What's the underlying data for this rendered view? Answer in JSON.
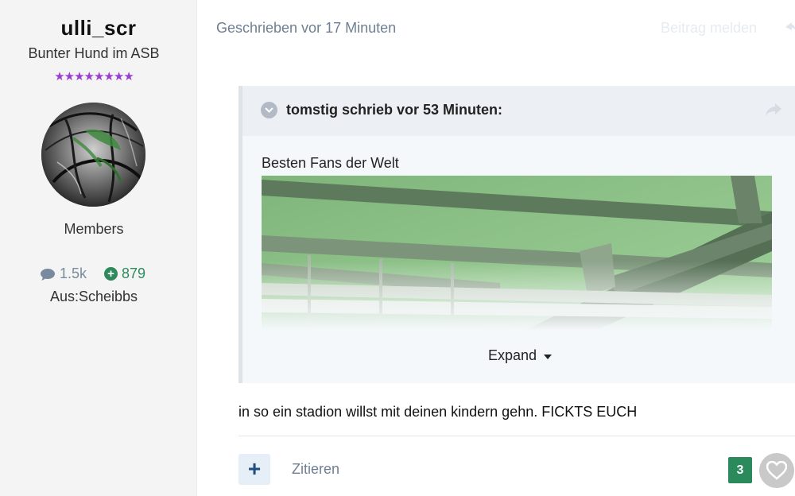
{
  "author": {
    "username": "ulli_scr",
    "title": "Bunter Hund im ASB",
    "stars": "★★★★★★★★",
    "group": "Members",
    "posts_count": "1.5k",
    "reputation": "879",
    "location": "Aus:Scheibbs",
    "colors": {
      "stars": "#9a3dd1",
      "reputation": "#2e8a5c",
      "posts": "#7a8a9e"
    }
  },
  "post": {
    "date": "Geschrieben vor 17 Minuten",
    "report_label": "Beitrag melden",
    "body": "in so ein stadion willst mit deinen kindern gehn. FICKTS EUCH"
  },
  "quote": {
    "citation": "tomstig schrieb vor 53 Minuten:",
    "text": "Besten Fans der Welt",
    "expand_label": "Expand"
  },
  "footer": {
    "quote_label": "Zitieren",
    "add_label": "+",
    "reaction_count": "3",
    "colors": {
      "reaction": "#2a8a5c",
      "add_button_bg": "#e6eff8"
    }
  },
  "icons": {
    "posts": "comment-icon",
    "reputation": "plus-circle-icon",
    "toggle": "chevron-down-icon",
    "share": "share-icon",
    "reaction": "heart-icon"
  }
}
